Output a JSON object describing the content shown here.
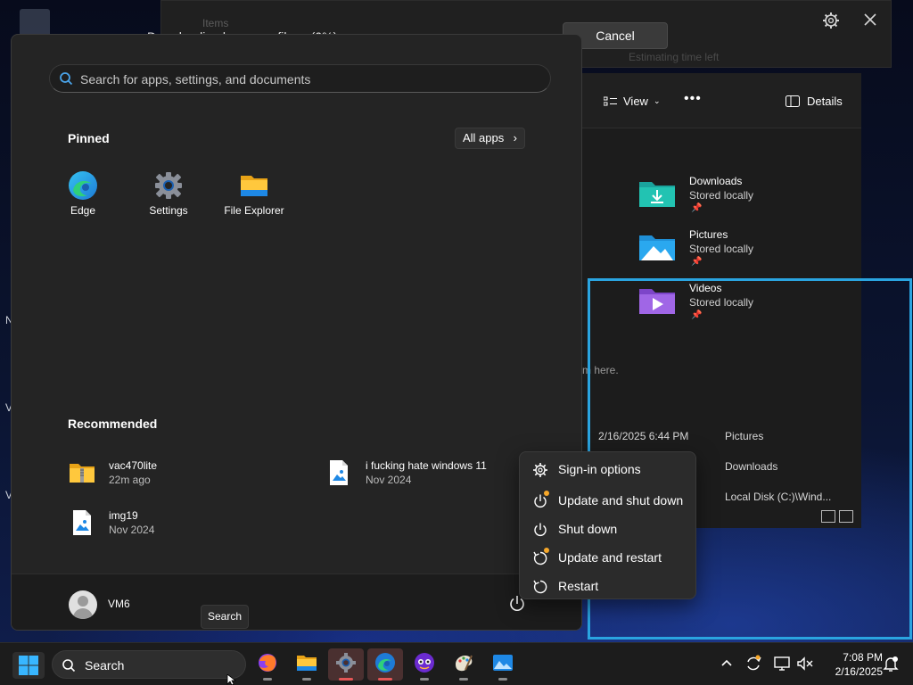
{
  "background_window": {
    "title": "Items",
    "status": "Downloading language files - (0%)",
    "subtext": "Estimating time left",
    "cancel_label": "Cancel"
  },
  "explorer": {
    "view_label": "View",
    "details_label": "Details",
    "folders": [
      {
        "name": "Downloads",
        "status": "Stored locally",
        "icon": "downloads-folder-icon",
        "color": "#1aa39c"
      },
      {
        "name": "Pictures",
        "status": "Stored locally",
        "icon": "pictures-folder-icon",
        "color": "#1f8fd6"
      },
      {
        "name": "Videos",
        "status": "Stored locally",
        "icon": "videos-folder-icon",
        "color": "#8a4fd3"
      }
    ],
    "hint_text": "m here.",
    "recent_date": "2/16/2025 6:44 PM",
    "locations": [
      "Pictures",
      "Downloads",
      "Local Disk (C:)\\Wind..."
    ]
  },
  "desktop": {
    "side_letters": [
      "N",
      "V",
      "V"
    ]
  },
  "start_menu": {
    "search_placeholder": "Search for apps, settings, and documents",
    "pinned_title": "Pinned",
    "all_apps_label": "All apps",
    "pinned_apps": [
      {
        "label": "Edge",
        "icon": "edge-icon"
      },
      {
        "label": "Settings",
        "icon": "settings-gear-icon"
      },
      {
        "label": "File Explorer",
        "icon": "file-explorer-icon"
      }
    ],
    "recommended_title": "Recommended",
    "recommended": [
      {
        "name": "vac470lite",
        "time": "22m ago",
        "icon": "zip-folder-icon"
      },
      {
        "name": "i fucking hate windows 11",
        "time": "Nov 2024",
        "icon": "image-file-icon"
      },
      {
        "name": "img19",
        "time": "Nov 2024",
        "icon": "image-file-icon"
      }
    ],
    "user_name": "VM6"
  },
  "power_menu": {
    "items": [
      {
        "label": "Sign-in options",
        "icon": "gear-icon"
      },
      {
        "label": "Update and shut down",
        "icon": "update-power-icon"
      },
      {
        "label": "Shut down",
        "icon": "power-icon"
      },
      {
        "label": "Update and restart",
        "icon": "update-restart-icon"
      },
      {
        "label": "Restart",
        "icon": "restart-icon"
      }
    ]
  },
  "tooltip": "Search",
  "taskbar": {
    "search_label": "Search",
    "apps": [
      "firefox-icon",
      "file-explorer-icon",
      "settings-gear-icon",
      "edge-icon",
      "app-icon",
      "paint-icon",
      "photos-icon"
    ],
    "time": "7:08 PM",
    "date": "2/16/2025"
  },
  "colors": {
    "accent": "#2aa4e0",
    "update_dot": "#f7a82a",
    "start_bg": "#242424"
  }
}
